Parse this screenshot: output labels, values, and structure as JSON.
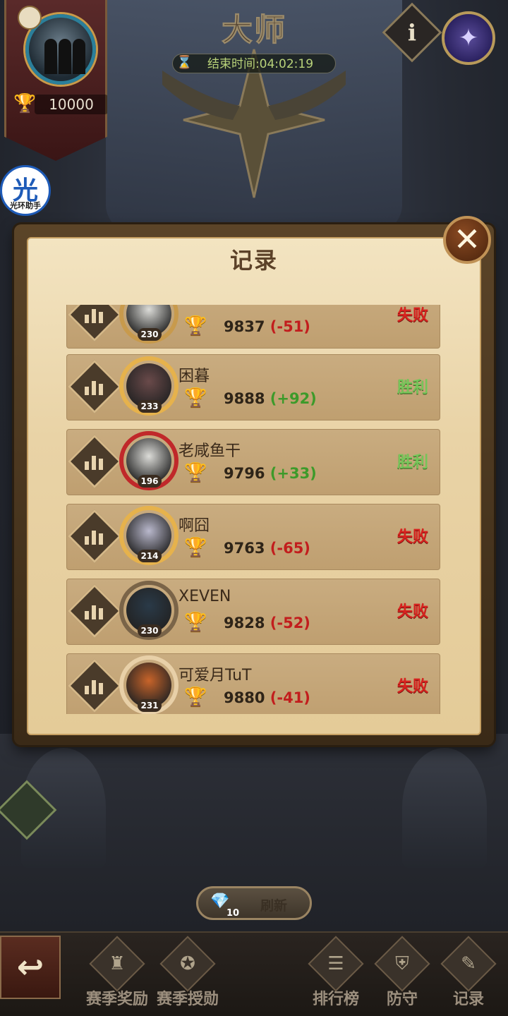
{
  "header": {
    "tier_title": "大师",
    "end_time": "结束时间:04:02:19"
  },
  "player": {
    "trophies": "10000"
  },
  "helper_badge": {
    "glyph": "光",
    "label": "光环助手"
  },
  "panel": {
    "title": "记录",
    "close_label": "✕"
  },
  "records": [
    {
      "name": "",
      "level": "230",
      "score": "9837",
      "delta": "(-51)",
      "result": "失败",
      "outcome": "loss",
      "ring": "#c89a4c",
      "face": "#dcdcd8"
    },
    {
      "name": "困暮",
      "level": "233",
      "score": "9888",
      "delta": "(+92)",
      "result": "胜利",
      "outcome": "win",
      "ring": "#e6b24c",
      "face": "#6a4a4a"
    },
    {
      "name": "老咸鱼干",
      "level": "196",
      "score": "9796",
      "delta": "(+33)",
      "result": "胜利",
      "outcome": "win",
      "ring": "#c0282a",
      "face": "#dcdcd8"
    },
    {
      "name": "啊囧",
      "level": "214",
      "score": "9763",
      "delta": "(-65)",
      "result": "失败",
      "outcome": "loss",
      "ring": "#e6b24c",
      "face": "#b9b8cc"
    },
    {
      "name": "XEVEN",
      "level": "230",
      "score": "9828",
      "delta": "(-52)",
      "result": "失败",
      "outcome": "loss",
      "ring": "#7a6448",
      "face": "#2a3a48"
    },
    {
      "name": "可爱月TuT",
      "level": "231",
      "score": "9880",
      "delta": "(-41)",
      "result": "失败",
      "outcome": "loss",
      "ring": "#e8d0a8",
      "face": "#c8642a"
    }
  ],
  "refresh": {
    "cost": "10",
    "label": "刷新"
  },
  "bottom_nav": {
    "back_label": "↩",
    "items": [
      {
        "label": "赛季奖励",
        "icon": "chest-icon"
      },
      {
        "label": "赛季授勋",
        "icon": "medal-icon"
      },
      {
        "label": "排行榜",
        "icon": "leaderboard-icon"
      },
      {
        "label": "防守",
        "icon": "shield-icon"
      },
      {
        "label": "记录",
        "icon": "scroll-icon"
      }
    ]
  },
  "colors": {
    "win": "#77c55a",
    "loss": "#d8231f",
    "panel_bg": "#e9d3a6"
  }
}
